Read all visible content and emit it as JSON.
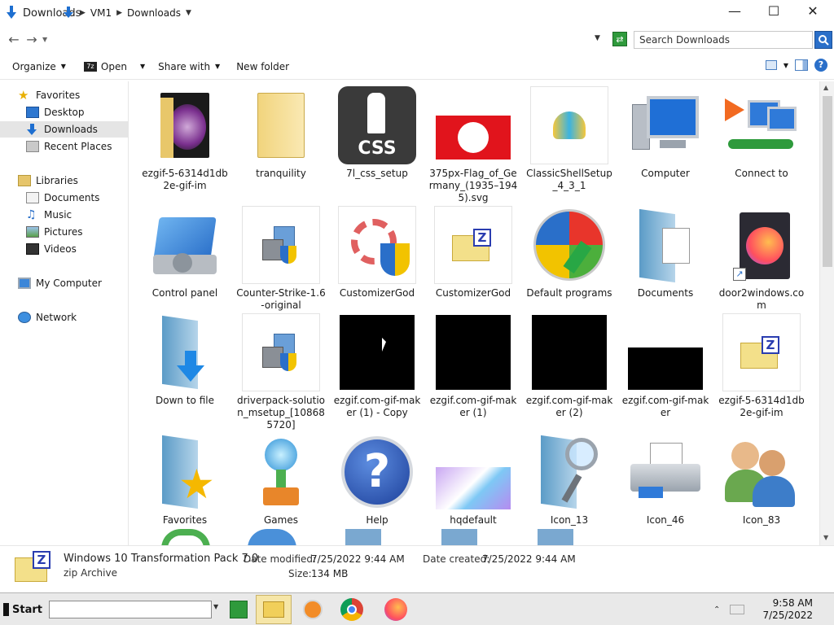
{
  "window": {
    "title": "Downloads"
  },
  "address": {
    "crumbs": [
      "VM1",
      "Downloads"
    ],
    "search_placeholder": "Search Downloads"
  },
  "toolbar": {
    "organize": "Organize",
    "open": "Open",
    "share_with": "Share with",
    "new_folder": "New folder"
  },
  "sidebar": {
    "favorites": "Favorites",
    "desktop": "Desktop",
    "downloads": "Downloads",
    "recent_places": "Recent Places",
    "libraries": "Libraries",
    "documents": "Documents",
    "music": "Music",
    "pictures": "Pictures",
    "videos": "Videos",
    "my_computer": "My Computer",
    "network": "Network"
  },
  "files": [
    {
      "label": "ezgif-5-6314d1db2e-gif-im",
      "icon": "folder-image-icon"
    },
    {
      "label": "tranquility",
      "icon": "folder-icon"
    },
    {
      "label": "7l_css_setup",
      "icon": "css-icon"
    },
    {
      "label": "375px-Flag_of_Germany_(1935–1945).svg",
      "icon": "flag-image-icon"
    },
    {
      "label": "ClassicShellSetup_4_3_1",
      "icon": "shell-icon"
    },
    {
      "label": "Computer",
      "icon": "computer-icon"
    },
    {
      "label": "Connect to",
      "icon": "network-connect-icon"
    },
    {
      "label": "Control panel",
      "icon": "control-panel-icon"
    },
    {
      "label": "Counter-Strike-1.6-original",
      "icon": "installer-icon"
    },
    {
      "label": "CustomizerGod",
      "icon": "gear-shield-icon"
    },
    {
      "label": "CustomizerGod",
      "icon": "zip-folder-icon"
    },
    {
      "label": "Default programs",
      "icon": "default-programs-icon"
    },
    {
      "label": "Documents",
      "icon": "documents-library-icon"
    },
    {
      "label": "door2windows.com",
      "icon": "firefox-shortcut-icon"
    },
    {
      "label": "Down to file",
      "icon": "download-folder-icon"
    },
    {
      "label": "driverpack-solution_msetup_[108685720]",
      "icon": "installer-icon"
    },
    {
      "label": "ezgif.com-gif-maker (1) - Copy",
      "icon": "black-image-icon"
    },
    {
      "label": "ezgif.com-gif-maker (1)",
      "icon": "black-image-icon"
    },
    {
      "label": "ezgif.com-gif-maker (2)",
      "icon": "black-image-icon"
    },
    {
      "label": "ezgif.com-gif-maker",
      "icon": "black-image-icon"
    },
    {
      "label": "ezgif-5-6314d1db2e-gif-im",
      "icon": "zip-folder-icon"
    },
    {
      "label": "Favorites",
      "icon": "favorites-folder-icon"
    },
    {
      "label": "Games",
      "icon": "games-trophy-icon"
    },
    {
      "label": "Help",
      "icon": "help-icon"
    },
    {
      "label": "hqdefault",
      "icon": "image-icon"
    },
    {
      "label": "Icon_13",
      "icon": "search-folder-icon"
    },
    {
      "label": "Icon_46",
      "icon": "printer-icon"
    },
    {
      "label": "Icon_83",
      "icon": "users-icon"
    }
  ],
  "details": {
    "name": "Windows 10 Transformation Pack 7.0",
    "type": "zip Archive",
    "date_modified_label": "Date modified:",
    "date_modified": "7/25/2022 9:44 AM",
    "date_created_label": "Date created:",
    "date_created": "7/25/2022 9:44 AM",
    "size_label": "Size:",
    "size": "134 MB"
  },
  "taskbar": {
    "start": "Start",
    "time": "9:58 AM",
    "date": "7/25/2022"
  }
}
